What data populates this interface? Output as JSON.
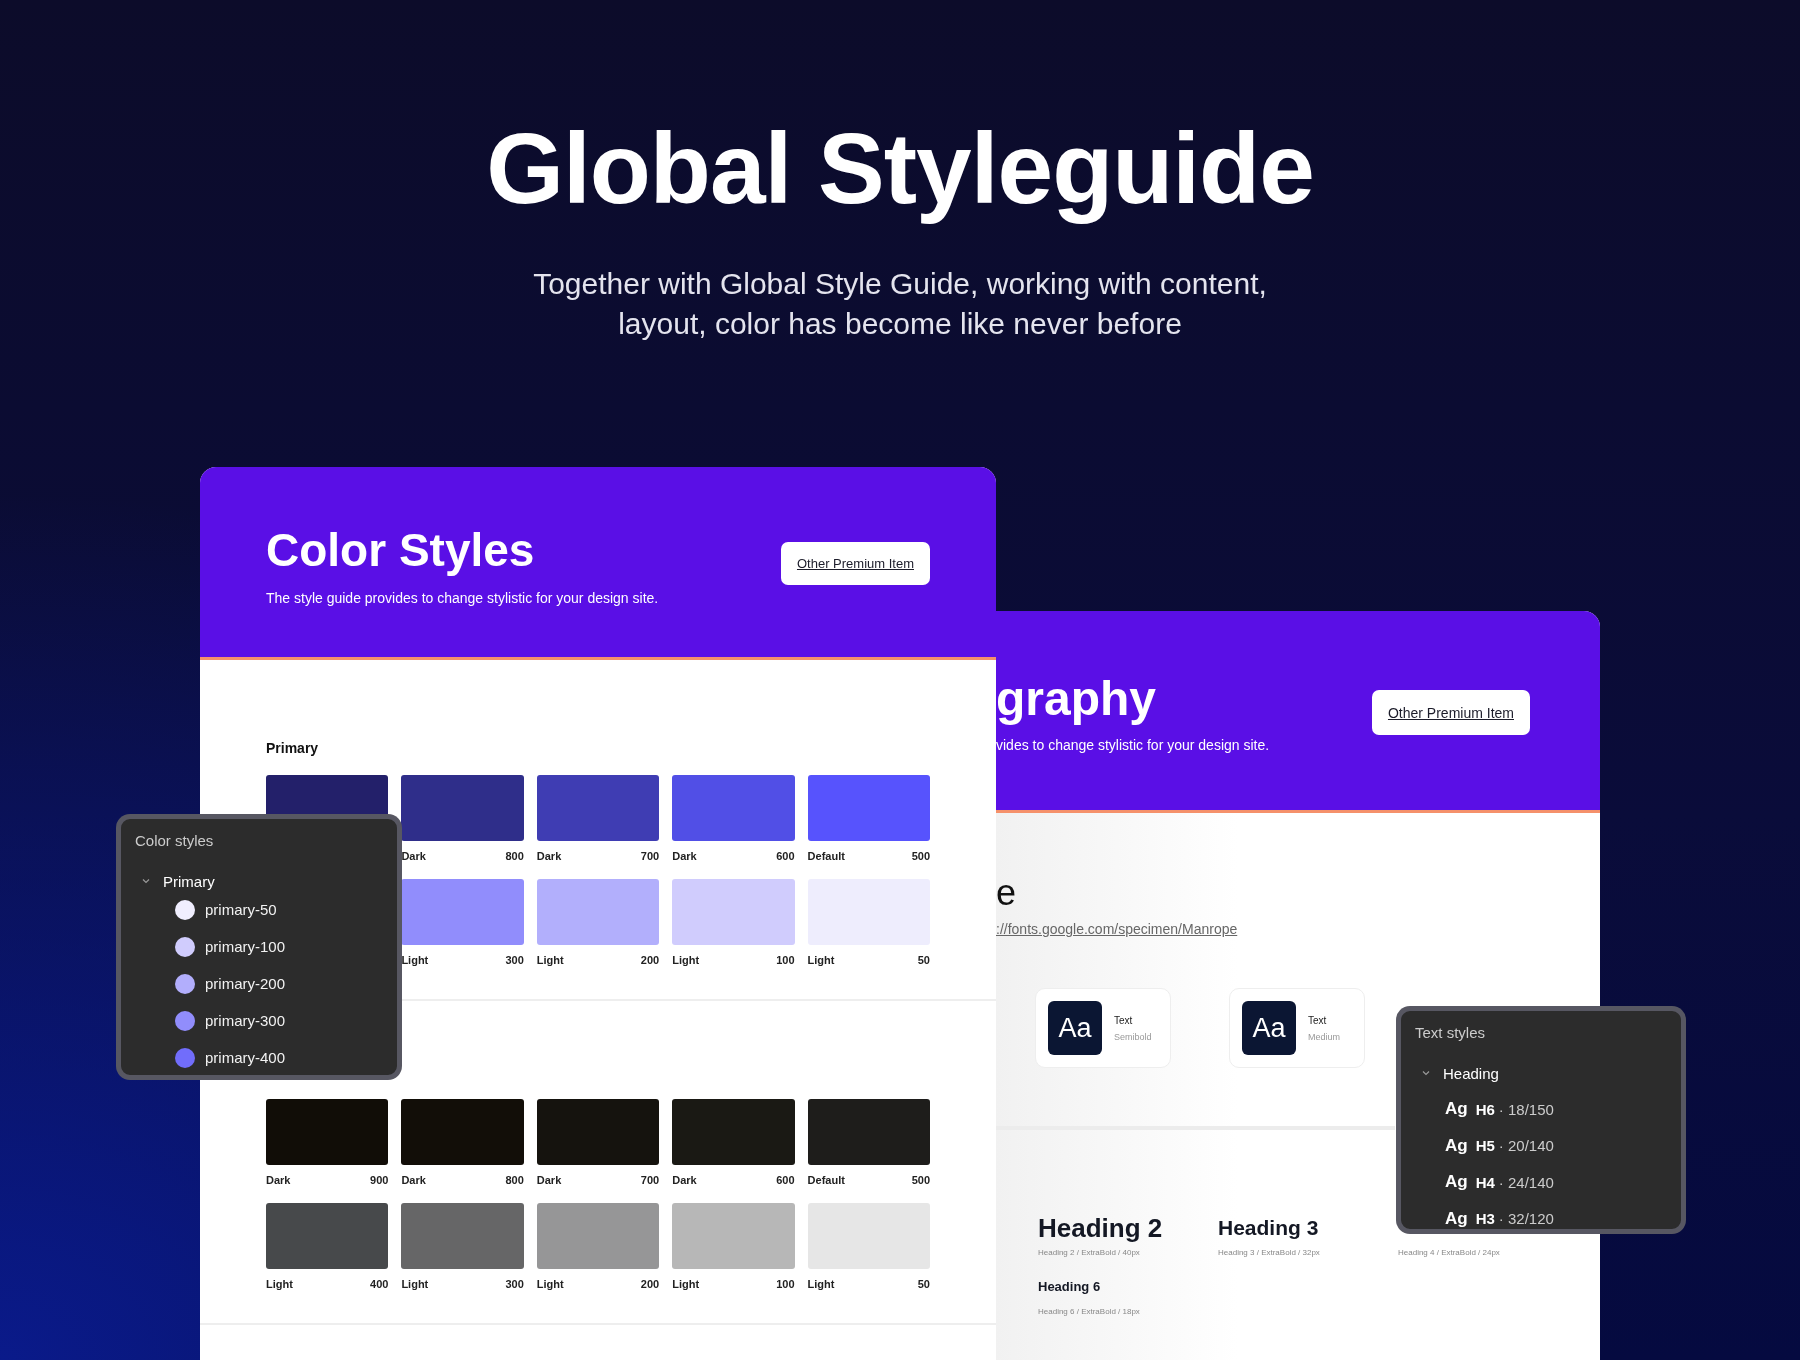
{
  "hero": {
    "title": "Global Styleguide",
    "subtitle_lines": [
      "Together with Global Style Guide, working with content,",
      "layout, color has become like never before"
    ]
  },
  "color_card": {
    "title": "Color Styles",
    "description": "The style guide provides to change stylistic for your design site.",
    "button": "Other Premium Item",
    "groups": [
      {
        "title": "Primary",
        "rows": [
          [
            {
              "kind": "swatch",
              "color": "#23206a"
            },
            {
              "kind": "swatch",
              "color": "#2f2e8a",
              "label": "Dark",
              "value": "800"
            },
            {
              "kind": "swatch",
              "color": "#3f3db3",
              "label": "Dark",
              "value": "700"
            },
            {
              "kind": "swatch",
              "color": "#514fe6",
              "label": "Dark",
              "value": "600"
            },
            {
              "kind": "swatch",
              "color": "#5753fd",
              "label": "Default",
              "value": "500"
            }
          ],
          [
            {
              "kind": "covered"
            },
            {
              "kind": "swatch",
              "color": "#918dfc",
              "label": "Light",
              "value": "300"
            },
            {
              "kind": "swatch",
              "color": "#b2affc",
              "label": "Light",
              "value": "200"
            },
            {
              "kind": "swatch",
              "color": "#d0ccfd",
              "label": "Light",
              "value": "100"
            },
            {
              "kind": "swatch",
              "color": "#eeedfd",
              "label": "Light",
              "value": "50"
            }
          ]
        ]
      },
      {
        "rows": [
          [
            {
              "kind": "swatch",
              "color": "#110d07",
              "label": "Dark",
              "value": "900"
            },
            {
              "kind": "swatch",
              "color": "#120e08",
              "label": "Dark",
              "value": "800"
            },
            {
              "kind": "swatch",
              "color": "#15130e",
              "label": "Dark",
              "value": "700"
            },
            {
              "kind": "swatch",
              "color": "#1a1914",
              "label": "Dark",
              "value": "600"
            },
            {
              "kind": "swatch",
              "color": "#1e1d1b",
              "label": "Default",
              "value": "500"
            }
          ],
          [
            {
              "kind": "swatch",
              "color": "#47494b",
              "label": "Light",
              "value": "400"
            },
            {
              "kind": "swatch",
              "color": "#666667",
              "label": "Light",
              "value": "300"
            },
            {
              "kind": "swatch",
              "color": "#969697",
              "label": "Light",
              "value": "200"
            },
            {
              "kind": "swatch",
              "color": "#b7b7b7",
              "label": "Light",
              "value": "100"
            },
            {
              "kind": "swatch",
              "color": "#e6e6e6",
              "label": "Light",
              "value": "50"
            }
          ]
        ]
      }
    ]
  },
  "typography_card": {
    "title": "graphy",
    "description": "vides to change stylistic for your design site.",
    "button": "Other Premium Item",
    "font_name": "e",
    "font_link": "://fonts.google.com/specimen/Manrope",
    "samples": [
      {
        "glyph": "Aa",
        "label": "Text",
        "weight": "Semibold"
      },
      {
        "glyph": "Aa",
        "label": "Text",
        "weight": "Medium"
      }
    ],
    "headings": [
      {
        "kind": "h2",
        "title": "Heading 2",
        "caption": "Heading 2 / ExtraBold / 40px"
      },
      {
        "kind": "h3",
        "title": "Heading 3",
        "caption": "Heading 3 / ExtraBold / 32px"
      },
      {
        "kind": "h4",
        "caption": "Heading 4 / ExtraBold / 24px"
      },
      {
        "kind": "h6",
        "title": "Heading 6",
        "caption": "Heading 6 / ExtraBold / 18px"
      }
    ]
  },
  "color_styles_panel": {
    "title": "Color styles",
    "group": {
      "label": "Primary",
      "expanded": true,
      "items": [
        {
          "name": "primary-50",
          "color": "#f0eefe"
        },
        {
          "name": "primary-100",
          "color": "#d0ccfd"
        },
        {
          "name": "primary-200",
          "color": "#b2aefc"
        },
        {
          "name": "primary-300",
          "color": "#918dfc"
        },
        {
          "name": "primary-400",
          "color": "#716dfb"
        }
      ]
    }
  },
  "text_styles_panel": {
    "title": "Text styles",
    "group": {
      "label": "Heading",
      "expanded": true,
      "items": [
        {
          "glyph": "Ag",
          "tag": "H6",
          "spec": "· 18/150"
        },
        {
          "glyph": "Ag",
          "tag": "H5",
          "spec": "· 20/140"
        },
        {
          "glyph": "Ag",
          "tag": "H4",
          "spec": "· 24/140"
        },
        {
          "glyph": "Ag",
          "tag": "H3",
          "spec": "· 32/120"
        }
      ]
    }
  }
}
